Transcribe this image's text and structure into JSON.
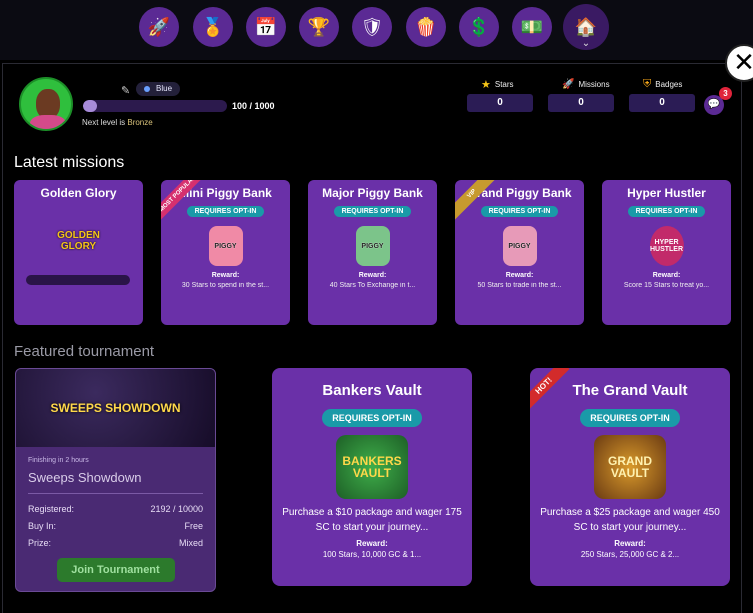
{
  "nav": {
    "icons": [
      "rocket-icon",
      "podium-icon",
      "calendar-icon",
      "trophy-icon",
      "shield-icon",
      "popcorn-icon",
      "coin-icon",
      "cash-icon",
      "home-icon"
    ]
  },
  "close_label": "✕",
  "profile": {
    "edit_icon": "✎",
    "tier_badge": "Blue",
    "progress_value": 100,
    "progress_max": 1000,
    "progress_text": "100 / 1000",
    "next_level_prefix": "Next level is",
    "next_level": "Bronze"
  },
  "stats": [
    {
      "label": "Stars",
      "value": "0",
      "icon": "star-icon"
    },
    {
      "label": "Missions",
      "value": "0",
      "icon": "rocket-icon"
    },
    {
      "label": "Badges",
      "value": "0",
      "icon": "badge-icon"
    }
  ],
  "chat": {
    "notifications": "3",
    "icon": "chat-icon"
  },
  "latest_missions": {
    "title": "Latest missions",
    "cards": [
      {
        "name": "Golden Glory",
        "logo": "GOLDEN GLORY",
        "ribbon": "",
        "opt_in": "",
        "reward_label": "",
        "reward_text": ""
      },
      {
        "name": "Mini Piggy Bank",
        "logo": "PIGGY",
        "ribbon": "MOST POPULAR",
        "opt_in": "REQUIRES OPT-IN",
        "reward_label": "Reward:",
        "reward_text": "30 Stars to spend in the st..."
      },
      {
        "name": "Major Piggy Bank",
        "logo": "PIGGY",
        "ribbon": "",
        "opt_in": "REQUIRES OPT-IN",
        "reward_label": "Reward:",
        "reward_text": "40 Stars To Exchange in t..."
      },
      {
        "name": "Grand Piggy Bank",
        "logo": "PIGGY",
        "ribbon": "VIP",
        "opt_in": "REQUIRES OPT-IN",
        "reward_label": "Reward:",
        "reward_text": "50 Stars to trade in the st..."
      },
      {
        "name": "Hyper Hustler",
        "logo": "HYPER HUSTLER",
        "ribbon": "",
        "opt_in": "REQUIRES OPT-IN",
        "reward_label": "Reward:",
        "reward_text": "Score 15 Stars to treat yo..."
      }
    ]
  },
  "featured": {
    "title": "Featured tournament",
    "tournament": {
      "banner": "SWEEPS SHOWDOWN",
      "finishing": "Finishing in 2 hours",
      "name": "Sweeps Showdown",
      "rows": [
        {
          "label": "Registered:",
          "value": "2192 / 10000"
        },
        {
          "label": "Buy In:",
          "value": "Free"
        },
        {
          "label": "Prize:",
          "value": "Mixed"
        }
      ],
      "join_label": "Join Tournament"
    }
  },
  "vaults": [
    {
      "name": "Bankers Vault",
      "ribbon": "",
      "opt_in": "REQUIRES OPT-IN",
      "logo": "BANKERS VAULT",
      "desc": "Purchase a $10 package and wager 175 SC to start your journey...",
      "reward_label": "Reward:",
      "reward_text": "100 Stars, 10,000 GC & 1..."
    },
    {
      "name": "The Grand Vault",
      "ribbon": "HOT!",
      "opt_in": "REQUIRES OPT-IN",
      "logo": "GRAND VAULT",
      "desc": "Purchase a $25 package and wager 450 SC to start your journey...",
      "reward_label": "Reward:",
      "reward_text": "250 Stars, 25,000 GC & 2..."
    }
  ]
}
